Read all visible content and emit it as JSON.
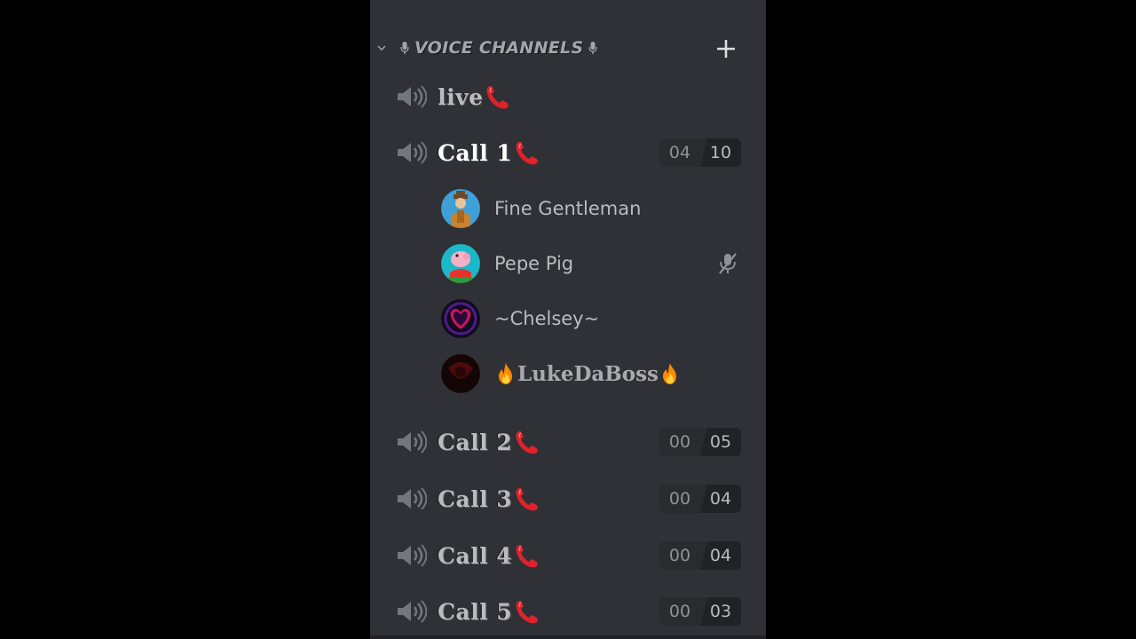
{
  "category": {
    "title": "VOICE CHANNELS"
  },
  "channels": [
    {
      "name": "live",
      "active": false
    },
    {
      "name": "Call 1",
      "active": true,
      "count": {
        "used": "04",
        "limit": "10"
      }
    },
    {
      "name": "Call 2",
      "active": false,
      "count": {
        "used": "00",
        "limit": "05"
      }
    },
    {
      "name": "Call 3",
      "active": false,
      "count": {
        "used": "00",
        "limit": "04"
      }
    },
    {
      "name": "Call 4",
      "active": false,
      "count": {
        "used": "00",
        "limit": "04"
      }
    },
    {
      "name": "Call 5",
      "active": false,
      "count": {
        "used": "00",
        "limit": "03"
      }
    }
  ],
  "voice_users": [
    {
      "name": "Fine Gentleman",
      "avatar": "gentleman-avatar"
    },
    {
      "name": "Pepe Pig",
      "avatar": "pig-avatar",
      "muted": true
    },
    {
      "name": "~Chelsey~",
      "avatar": "heart-avatar"
    },
    {
      "name": "LukeDaBoss",
      "avatar": "dark-avatar",
      "decor": "fire-emoji"
    }
  ],
  "icons": {
    "chevron": "chevron-down-icon",
    "mic": "microphone-icon",
    "add": "plus-icon",
    "speaker": "speaker-icon",
    "phone": "telephone-receiver-emoji",
    "mute": "muted-microphone-icon"
  },
  "colors": {
    "sidebar": "#2f3136",
    "text_muted": "#b9bbbe",
    "text_active": "#ffffff",
    "phone": "#e0222a",
    "fire": "#ff8a00"
  }
}
